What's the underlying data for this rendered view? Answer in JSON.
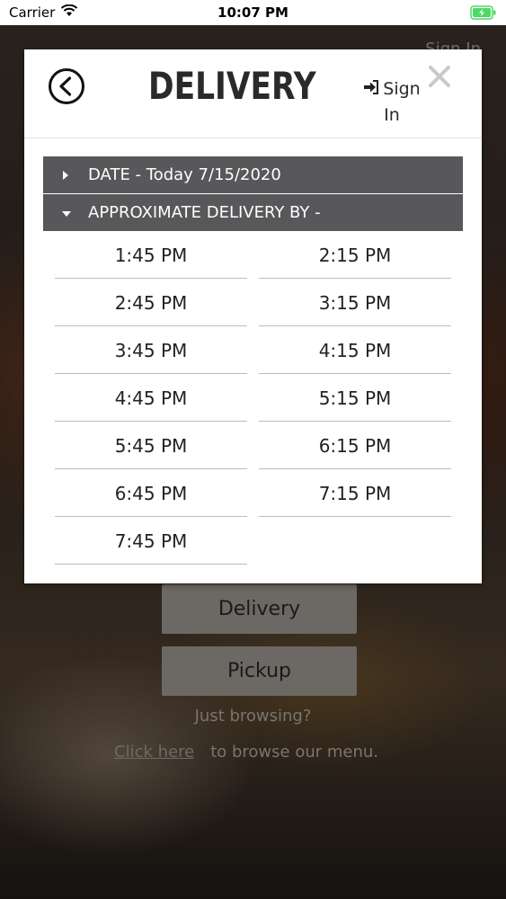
{
  "status_bar": {
    "carrier": "Carrier",
    "time": "10:07 PM"
  },
  "background": {
    "sign_in": "Sign In",
    "delivery_button": "Delivery",
    "pickup_button": "Pickup",
    "just_browsing": "Just browsing?",
    "click_here": "Click here",
    "browse_text": "to browse our menu."
  },
  "modal": {
    "title": "DELIVERY",
    "sign_in": "Sign In",
    "date_label": "DATE - Today 7/15/2020",
    "approx_label": "APPROXIMATE DELIVERY BY -",
    "time_slots": [
      "1:45 PM",
      "2:15 PM",
      "2:45 PM",
      "3:15 PM",
      "3:45 PM",
      "4:15 PM",
      "4:45 PM",
      "5:15 PM",
      "5:45 PM",
      "6:15 PM",
      "6:45 PM",
      "7:15 PM",
      "7:45 PM"
    ]
  },
  "colors": {
    "bar_bg": "#58575a",
    "modal_bg": "#ffffff",
    "battery_green": "#4cd964"
  }
}
